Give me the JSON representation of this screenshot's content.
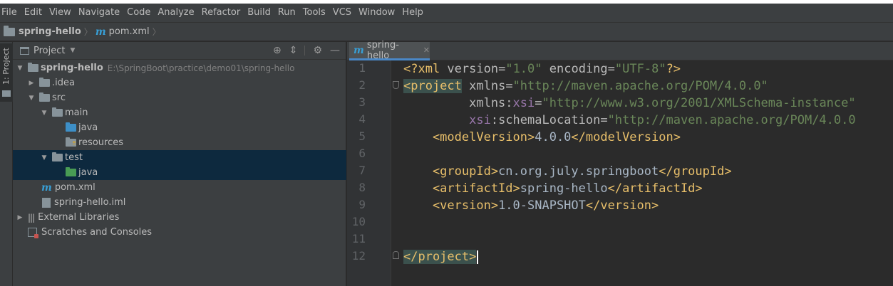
{
  "menu": [
    "File",
    "Edit",
    "View",
    "Navigate",
    "Code",
    "Analyze",
    "Refactor",
    "Build",
    "Run",
    "Tools",
    "VCS",
    "Window",
    "Help"
  ],
  "navbar": {
    "project": "spring-hello",
    "file": "pom.xml",
    "sep": "〉"
  },
  "toolstrip": {
    "label": "1: Project"
  },
  "panel": {
    "title": "Project"
  },
  "tree": {
    "root": {
      "name": "spring-hello",
      "path": "E:\\SpringBoot\\practice\\demo01\\spring-hello"
    },
    "idea": ".idea",
    "src": "src",
    "main": "main",
    "main_java": "java",
    "resources": "resources",
    "test": "test",
    "test_java": "java",
    "pom": "pom.xml",
    "iml": "spring-hello.iml",
    "ext": "External Libraries",
    "scratches": "Scratches and Consoles"
  },
  "editor": {
    "tab_label": "spring-hello",
    "line_numbers": [
      "1",
      "2",
      "3",
      "4",
      "5",
      "6",
      "7",
      "8",
      "9",
      "10",
      "11",
      "12"
    ],
    "code": {
      "l1": {
        "a": "<?xml ",
        "b": "version",
        "c": "=",
        "d": "\"1.0\"",
        "e": " ",
        "f": "encoding",
        "g": "=",
        "h": "\"UTF-8\"",
        "i": "?>"
      },
      "l2": {
        "a": "<project",
        "b": " xmlns",
        "c": "=",
        "d": "\"http://maven.apache.org/POM/4.0.0\""
      },
      "l3": {
        "a": "         xmlns",
        "b": ":",
        "c": "xsi",
        "d": "=",
        "e": "\"http://www.w3.org/2001/XMLSchema-instance\""
      },
      "l4": {
        "a": "         ",
        "b": "xsi",
        "c": ":schemaLocation",
        "d": "=",
        "e": "\"http://maven.apache.org/POM/4.0.0"
      },
      "l5": {
        "a": "    <modelVersion>",
        "b": "4.0.0",
        "c": "</modelVersion>"
      },
      "l7": {
        "a": "    <groupId>",
        "b": "cn.org.july.springboot",
        "c": "</groupId>"
      },
      "l8": {
        "a": "    <artifactId>",
        "b": "spring-hello",
        "c": "</artifactId>"
      },
      "l9": {
        "a": "    <version>",
        "b": "1.0-SNAPSHOT",
        "c": "</version>"
      },
      "l12": {
        "a": "</project>"
      }
    }
  }
}
